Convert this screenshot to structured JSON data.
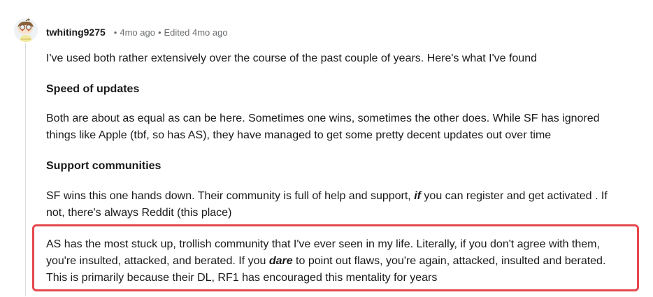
{
  "comment": {
    "username": "twhiting9275",
    "time_ago": "4mo ago",
    "edited_label": "Edited 4mo ago",
    "separator": "•",
    "paragraphs": {
      "intro": "I've used both rather extensively over the course of the past couple of years. Here's what I've found",
      "heading_updates": "Speed of updates",
      "updates_line1": "Both are about as equal as can be here. Sometimes one wins, sometimes the other does. While SF has ignored",
      "updates_line2": "things like Apple (tbf, so has AS), they have managed to get some pretty decent updates out over time",
      "heading_support": "Support communities",
      "support_l1_a": "SF wins this one hands down. Their community is full of help and support, ",
      "support_l1_emph": "if",
      "support_l1_b": " you can register and get activated . If",
      "support_l2": "not, there's always Reddit (this place)",
      "as_l1": "AS has the most stuck up, trollish community that I've ever seen in my life. Literally, if you don't agree with them,",
      "as_l2_a": "you're insulted, attacked, and berated. If you ",
      "as_l2_emph": "dare",
      "as_l2_b": " to point out flaws, you're again, attacked, insulted and berated.",
      "as_l3": "This is primarily because their DL, RF1 has encouraged this mentality for years"
    }
  },
  "colors": {
    "highlight_border": "#e5484d",
    "thread_line": "#d8dcdf",
    "meta_text": "#6b6e70"
  },
  "icons": {
    "avatar": "snoo-avatar-icon"
  }
}
